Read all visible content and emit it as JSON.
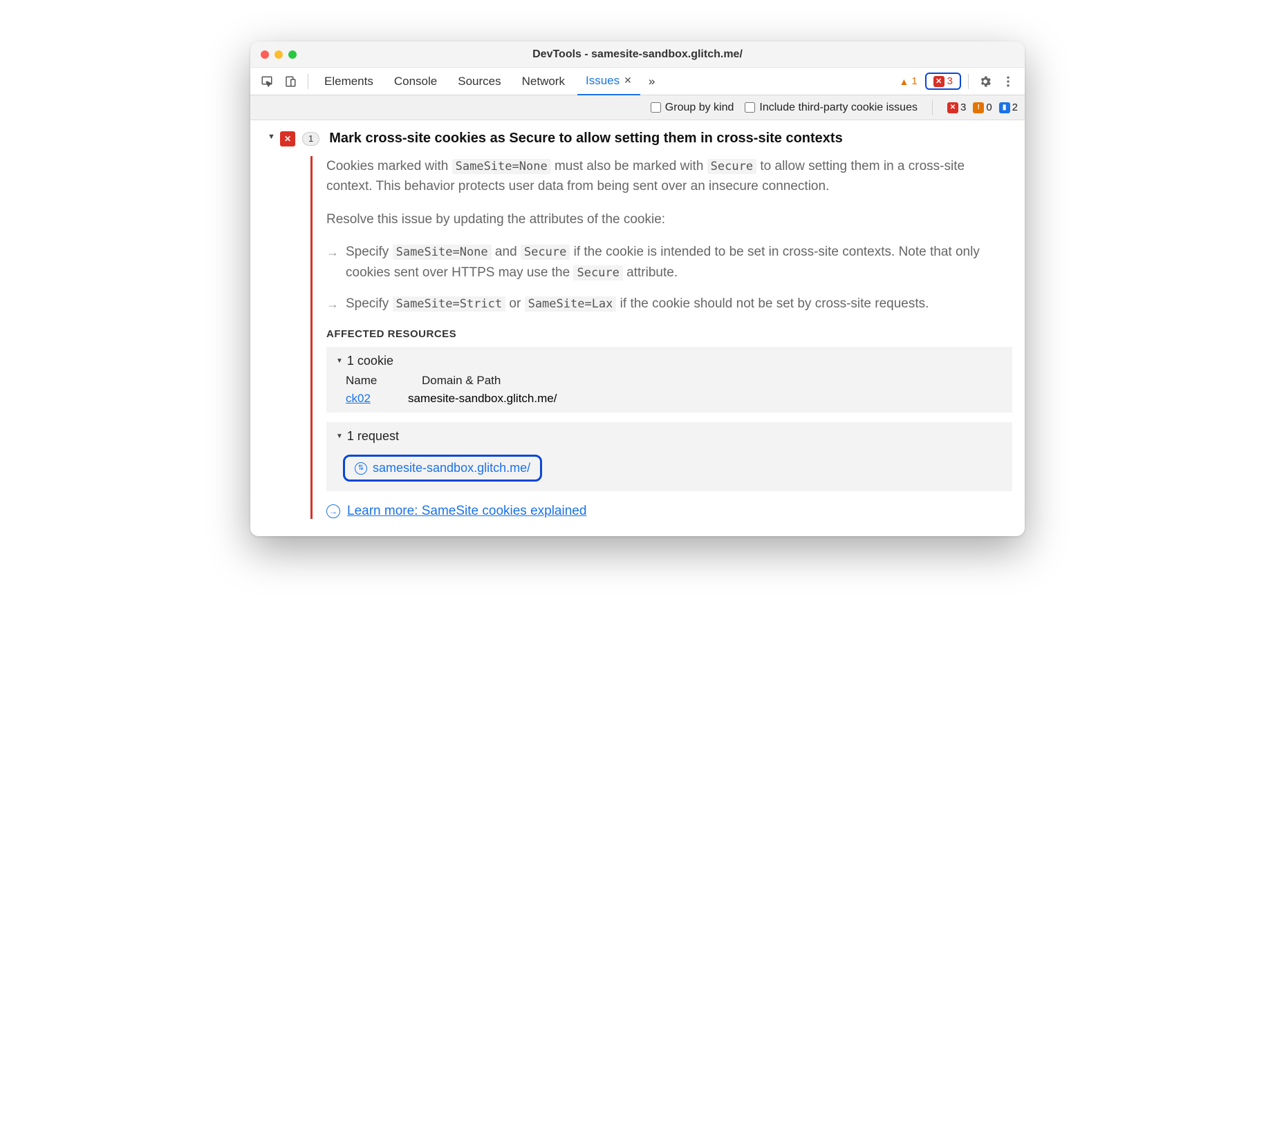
{
  "window": {
    "title": "DevTools - samesite-sandbox.glitch.me/"
  },
  "traffic": {
    "close": "#ff5f57",
    "min": "#febc2e",
    "max": "#28c840"
  },
  "tabs": {
    "items": [
      "Elements",
      "Console",
      "Sources",
      "Network"
    ],
    "active": "Issues",
    "close_x": "✕",
    "more": "»"
  },
  "toolbar": {
    "warn_count": "1",
    "err_count": "3"
  },
  "subtoolbar": {
    "group_label": "Group by kind",
    "third_party_label": "Include third-party cookie issues",
    "err": "3",
    "warn": "0",
    "info": "2"
  },
  "issue": {
    "count": "1",
    "title": "Mark cross-site cookies as Secure to allow setting them in cross-site contexts",
    "desc_parts": {
      "p1a": "Cookies marked with ",
      "c1": "SameSite=None",
      "p1b": " must also be marked with ",
      "c2": "Secure",
      "p1c": " to allow setting them in a cross-site context. This behavior protects user data from being sent over an insecure connection."
    },
    "resolve": "Resolve this issue by updating the attributes of the cookie:",
    "step1": {
      "a": "Specify ",
      "c1": "SameSite=None",
      "mid": " and ",
      "c2": "Secure",
      "b": " if the cookie is intended to be set in cross-site contexts. Note that only cookies sent over HTTPS may use the ",
      "c3": "Secure",
      "c": " attribute."
    },
    "step2": {
      "a": "Specify ",
      "c1": "SameSite=Strict",
      "mid": " or ",
      "c2": "SameSite=Lax",
      "b": " if the cookie should not be set by cross-site requests."
    },
    "aff_title": "AFFECTED RESOURCES",
    "cookies": {
      "header": "1 cookie",
      "cols": {
        "name": "Name",
        "domain": "Domain & Path"
      },
      "row": {
        "name": "ck02",
        "domain": "samesite-sandbox.glitch.me/"
      }
    },
    "requests": {
      "header": "1 request",
      "item": "samesite-sandbox.glitch.me/"
    },
    "learn": "Learn more: SameSite cookies explained"
  }
}
